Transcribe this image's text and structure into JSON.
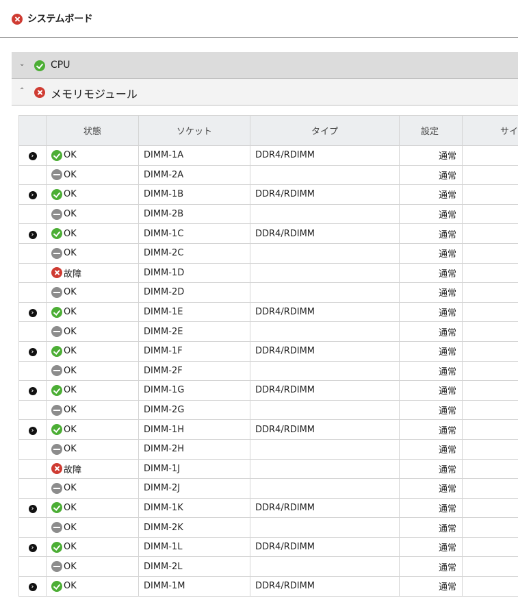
{
  "header": {
    "title": "システムボード",
    "status_icon": "error-icon"
  },
  "sections": {
    "cpu": {
      "title": "CPU",
      "expanded": false,
      "status_icon": "ok-icon"
    },
    "memory": {
      "title": "メモリモジュール",
      "expanded": true,
      "status_icon": "error-icon"
    }
  },
  "table": {
    "columns": {
      "expand": "",
      "status": "状態",
      "socket": "ソケット",
      "type": "タイプ",
      "setting": "設定",
      "size": "サイ"
    },
    "rows": [
      {
        "expand": true,
        "status": "ok",
        "status_text": "OK",
        "socket": "DIMM-1A",
        "type": "DDR4/RDIMM",
        "setting": "通常",
        "size": ""
      },
      {
        "expand": false,
        "status": "absent",
        "status_text": "OK",
        "socket": "DIMM-2A",
        "type": "",
        "setting": "通常",
        "size": ""
      },
      {
        "expand": true,
        "status": "ok",
        "status_text": "OK",
        "socket": "DIMM-1B",
        "type": "DDR4/RDIMM",
        "setting": "通常",
        "size": ""
      },
      {
        "expand": false,
        "status": "absent",
        "status_text": "OK",
        "socket": "DIMM-2B",
        "type": "",
        "setting": "通常",
        "size": ""
      },
      {
        "expand": true,
        "status": "ok",
        "status_text": "OK",
        "socket": "DIMM-1C",
        "type": "DDR4/RDIMM",
        "setting": "通常",
        "size": ""
      },
      {
        "expand": false,
        "status": "absent",
        "status_text": "OK",
        "socket": "DIMM-2C",
        "type": "",
        "setting": "通常",
        "size": ""
      },
      {
        "expand": false,
        "status": "error",
        "status_text": "故障",
        "socket": "DIMM-1D",
        "type": "",
        "setting": "通常",
        "size": ""
      },
      {
        "expand": false,
        "status": "absent",
        "status_text": "OK",
        "socket": "DIMM-2D",
        "type": "",
        "setting": "通常",
        "size": ""
      },
      {
        "expand": true,
        "status": "ok",
        "status_text": "OK",
        "socket": "DIMM-1E",
        "type": "DDR4/RDIMM",
        "setting": "通常",
        "size": ""
      },
      {
        "expand": false,
        "status": "absent",
        "status_text": "OK",
        "socket": "DIMM-2E",
        "type": "",
        "setting": "通常",
        "size": ""
      },
      {
        "expand": true,
        "status": "ok",
        "status_text": "OK",
        "socket": "DIMM-1F",
        "type": "DDR4/RDIMM",
        "setting": "通常",
        "size": ""
      },
      {
        "expand": false,
        "status": "absent",
        "status_text": "OK",
        "socket": "DIMM-2F",
        "type": "",
        "setting": "通常",
        "size": ""
      },
      {
        "expand": true,
        "status": "ok",
        "status_text": "OK",
        "socket": "DIMM-1G",
        "type": "DDR4/RDIMM",
        "setting": "通常",
        "size": ""
      },
      {
        "expand": false,
        "status": "absent",
        "status_text": "OK",
        "socket": "DIMM-2G",
        "type": "",
        "setting": "通常",
        "size": ""
      },
      {
        "expand": true,
        "status": "ok",
        "status_text": "OK",
        "socket": "DIMM-1H",
        "type": "DDR4/RDIMM",
        "setting": "通常",
        "size": ""
      },
      {
        "expand": false,
        "status": "absent",
        "status_text": "OK",
        "socket": "DIMM-2H",
        "type": "",
        "setting": "通常",
        "size": ""
      },
      {
        "expand": false,
        "status": "error",
        "status_text": "故障",
        "socket": "DIMM-1J",
        "type": "",
        "setting": "通常",
        "size": ""
      },
      {
        "expand": false,
        "status": "absent",
        "status_text": "OK",
        "socket": "DIMM-2J",
        "type": "",
        "setting": "通常",
        "size": ""
      },
      {
        "expand": true,
        "status": "ok",
        "status_text": "OK",
        "socket": "DIMM-1K",
        "type": "DDR4/RDIMM",
        "setting": "通常",
        "size": ""
      },
      {
        "expand": false,
        "status": "absent",
        "status_text": "OK",
        "socket": "DIMM-2K",
        "type": "",
        "setting": "通常",
        "size": ""
      },
      {
        "expand": true,
        "status": "ok",
        "status_text": "OK",
        "socket": "DIMM-1L",
        "type": "DDR4/RDIMM",
        "setting": "通常",
        "size": ""
      },
      {
        "expand": false,
        "status": "absent",
        "status_text": "OK",
        "socket": "DIMM-2L",
        "type": "",
        "setting": "通常",
        "size": ""
      },
      {
        "expand": true,
        "status": "ok",
        "status_text": "OK",
        "socket": "DIMM-1M",
        "type": "DDR4/RDIMM",
        "setting": "通常",
        "size": ""
      }
    ]
  },
  "colors": {
    "ok": "#4cae35",
    "error": "#cf3b32",
    "absent": "#8c8c8c",
    "header_bg": "#eceef0",
    "section_bg": "#dcdcdc"
  }
}
